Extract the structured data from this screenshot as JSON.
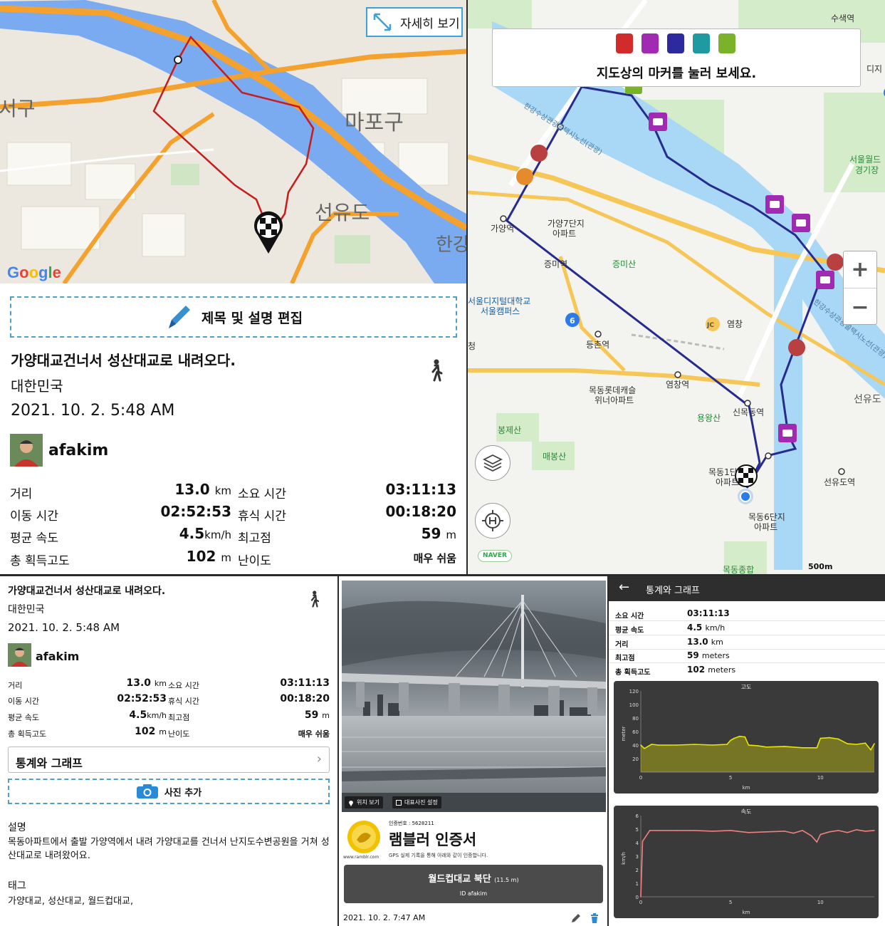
{
  "overview_card": {
    "detail_button_label": "자세히 보기",
    "map_labels": [
      "서구",
      "마포구",
      "선유도",
      "한강"
    ],
    "google_logo": "Google",
    "edit_button_label": "제목 및 설명 편집",
    "title": "가양대교건너서 성산대교로 내려오다.",
    "country": "대한민국",
    "datetime": "2021. 10. 2. 5:48 AM",
    "username": "afakim",
    "stats": [
      {
        "label": "거리",
        "value": "13.0",
        "unit": "km",
        "label2": "소요 시간",
        "value2": "03:11:13"
      },
      {
        "label": "이동 시간",
        "value": "02:52:53",
        "unit": "",
        "label2": "휴식 시간",
        "value2": "00:18:20"
      },
      {
        "label": "평균 속도",
        "value": "4.5",
        "unit": "km/h",
        "label2": "최고점",
        "value2": "59",
        "unit2": "m"
      },
      {
        "label": "총 획득고도",
        "value": "102",
        "unit": "m",
        "label2": "난이도",
        "value2": "매우 쉬움"
      }
    ]
  },
  "naver_map": {
    "hint": "지도상의 마커를 눌러 보세요.",
    "zoom_in": "+",
    "zoom_out": "−",
    "naver_logo": "NAVER",
    "scale": "500m",
    "labels": {
      "suseok": "수색역",
      "digital": "디지",
      "worldcup": "서울월드",
      "worldcup2": "경기장",
      "gayang_apt1": "가양7단지",
      "gayang_apt2": "아파트",
      "gayang_stn": "가양역",
      "jeungmi_stn": "증미역",
      "jeungmi_san": "증미산",
      "univ1": "서울디지털대학교",
      "univ2": "서울캠퍼스",
      "deungchon": "등촌역",
      "yeomchang": "염창역",
      "yeomchang_jc": "염창",
      "lotte1": "목동롯데캐슬",
      "lotte2": "위너아파트",
      "yongwang": "용왕산",
      "sinmok": "신목동역",
      "bongje": "봉제산",
      "maebong": "매봉산",
      "mokdong1_1": "목동1단",
      "mokdong1_2": "아파트",
      "mokdong6_1": "목동6단지",
      "mokdong6_2": "아파트",
      "seonyudo_stn": "선유도역",
      "seonyudo": "선유도",
      "mokdong_sports": "목동종합",
      "river_road1": "한강수상관광콜택시노선(관광)",
      "river_road2": "한강수상관광콜택시노선(관광)",
      "sign_cheong": "청",
      "route6": "6",
      "jc_badge": "JC"
    }
  },
  "detail_card": {
    "title": "가양대교건너서 성산대교로 내려오다.",
    "country": "대한민국",
    "datetime": "2021. 10. 2. 5:48 AM",
    "username": "afakim",
    "stats_link": "통계와 그래프",
    "stats_chevron": "›",
    "add_photo": "사진 추가",
    "description_label": "설명",
    "description": "목동아파트에서 출발 가양역에서 내려 가양대교를 건너서 난지도수변공원을 거쳐 성산대교로 내려왔어요.",
    "tags_label": "태그",
    "tags": "가양대교, 성산대교, 월드컵대교,"
  },
  "certificate": {
    "photo_location_btn": "위치 보기",
    "photo_cover_btn": "대표사진 설정",
    "cert_number": "인증번호 : 5628211",
    "cert_title": "램블러 인증서",
    "cert_subtitle": "GPS 실제 기록을 통해 아래와 같이 인증합니다.",
    "site": "www.ramblr.com",
    "location": "월드컵대교 북단",
    "elevation": "(11.5 m)",
    "user_id": "ID  afakim",
    "datetime": "2021. 10. 2. 7:47 AM"
  },
  "stats_screen": {
    "header": "통계와 그래프",
    "back": "←",
    "rows": [
      {
        "label": "소요 시간",
        "value": "03:11:13",
        "unit": ""
      },
      {
        "label": "평균 속도",
        "value": "4.5",
        "unit": "km/h"
      },
      {
        "label": "거리",
        "value": "13.0",
        "unit": "km"
      },
      {
        "label": "최고점",
        "value": "59",
        "unit": "meters"
      },
      {
        "label": "총 획득고도",
        "value": "102",
        "unit": "meters"
      }
    ]
  },
  "chart_data": [
    {
      "type": "area",
      "title": "고도",
      "xlabel": "km",
      "ylabel": "meter",
      "xlim": [
        0,
        13
      ],
      "ylim": [
        0,
        120
      ],
      "xticks": [
        0,
        5,
        10
      ],
      "yticks": [
        20,
        40,
        60,
        80,
        100,
        120
      ],
      "color": "#e6e600",
      "x": [
        0,
        0.2,
        0.6,
        1,
        2,
        3,
        4,
        4.8,
        5,
        5.2,
        5.5,
        5.8,
        6,
        6.5,
        7,
        8,
        9,
        9.8,
        10,
        10.5,
        11,
        11.5,
        12,
        12.5,
        12.8,
        13
      ],
      "y": [
        40,
        35,
        41,
        40,
        40,
        41,
        40,
        41,
        47,
        50,
        53,
        52,
        40,
        39,
        37,
        38,
        36,
        36,
        50,
        51,
        49,
        42,
        41,
        43,
        33,
        42
      ]
    },
    {
      "type": "line",
      "title": "속도",
      "xlabel": "km",
      "ylabel": "km/h",
      "xlim": [
        0,
        13
      ],
      "ylim": [
        0,
        6
      ],
      "xticks": [
        0,
        5,
        10
      ],
      "yticks": [
        0,
        1,
        2,
        3,
        4,
        5,
        6
      ],
      "color": "#f08080",
      "x": [
        0,
        0.1,
        0.3,
        0.5,
        1,
        2,
        3,
        4,
        5,
        6,
        7,
        8,
        8.5,
        9,
        9.5,
        9.8,
        10,
        10.5,
        11,
        11.5,
        12,
        12.5,
        13
      ],
      "y": [
        0,
        4.1,
        4.5,
        4.9,
        4.9,
        4.9,
        4.9,
        4.85,
        4.9,
        4.75,
        4.8,
        4.85,
        4.7,
        4.9,
        4.5,
        4.05,
        4.6,
        4.8,
        4.9,
        4.75,
        4.95,
        4.85,
        4.9
      ]
    }
  ]
}
